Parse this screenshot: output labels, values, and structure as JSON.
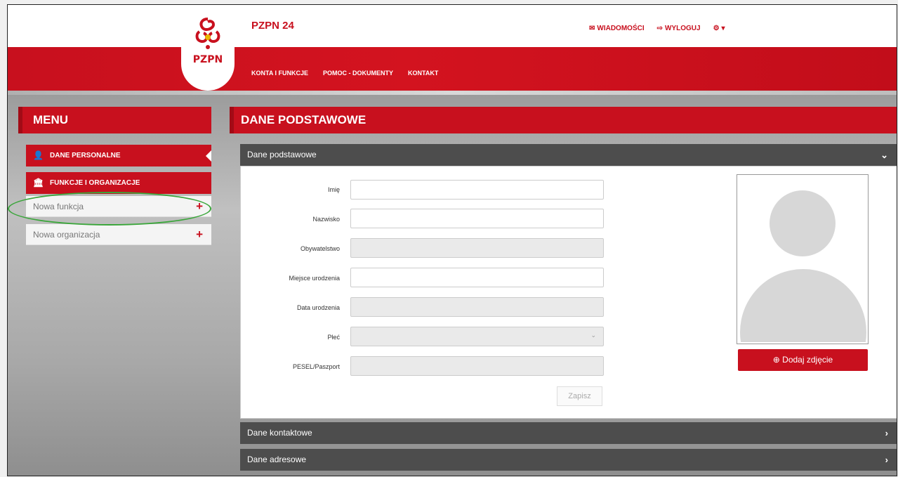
{
  "header": {
    "logo_text": "PZPN",
    "app_title": "PZPN 24",
    "top_links": {
      "messages": "WIADOMOŚCI",
      "logout": "WYLOGUJ",
      "settings": "▾"
    },
    "main_nav": [
      "KONTA I FUNKCJE",
      "POMOC - DOKUMENTY",
      "KONTAKT"
    ]
  },
  "sidebar": {
    "title": "MENU",
    "items": [
      {
        "label": "DANE PERSONALNE",
        "icon": "user-icon"
      },
      {
        "label": "FUNKCJE I ORGANIZACJE",
        "icon": "building-icon"
      }
    ],
    "sub_items": [
      {
        "label": "Nowa funkcja",
        "action": "+"
      },
      {
        "label": "Nowa organizacja",
        "action": "+"
      }
    ]
  },
  "main": {
    "title": "DANE PODSTAWOWE",
    "accordions": {
      "basic": "Dane podstawowe",
      "contact": "Dane kontaktowe",
      "address": "Dane adresowe"
    },
    "form": {
      "fields": [
        {
          "label": "Imię",
          "value": ""
        },
        {
          "label": "Nazwisko",
          "value": ""
        },
        {
          "label": "Obywatelstwo",
          "value": ""
        },
        {
          "label": "Miejsce urodzenia",
          "value": ""
        },
        {
          "label": "Data urodzenia",
          "value": ""
        },
        {
          "label": "Płeć",
          "value": ""
        },
        {
          "label": "PESEL/Paszport",
          "value": ""
        }
      ],
      "save_label": "Zapisz"
    },
    "photo": {
      "add_label": "Dodaj zdjęcie"
    }
  },
  "colors": {
    "brand_red": "#c8101e",
    "dark_bar": "#4d4d4d"
  }
}
